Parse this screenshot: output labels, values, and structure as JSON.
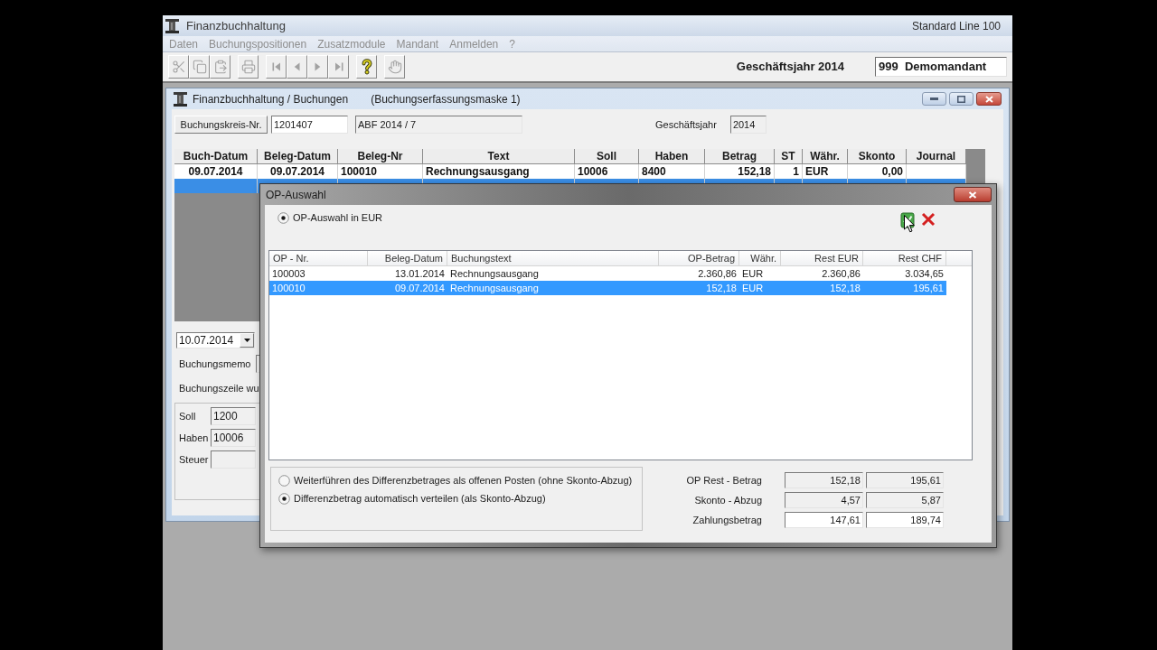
{
  "app_window": {
    "title": "Finanzbuchhaltung",
    "edition": "Standard Line 100"
  },
  "menu": [
    {
      "label": "Daten",
      "disabled": true
    },
    {
      "label": "Buchungspositionen",
      "disabled": true
    },
    {
      "label": "Zusatzmodule",
      "disabled": true
    },
    {
      "label": "Mandant",
      "disabled": true
    },
    {
      "label": "Anmelden",
      "disabled": true
    },
    {
      "label": "?",
      "disabled": true
    }
  ],
  "toolbar": {
    "groups": [
      [
        {
          "disabled": true
        },
        {
          "disabled": true
        },
        {
          "disabled": true
        }
      ],
      [
        {
          "disabled": true
        }
      ],
      [
        {
          "disabled": true
        },
        {
          "disabled": true
        },
        {
          "disabled": true
        },
        {
          "disabled": true
        }
      ],
      [
        {
          "disabled": false
        }
      ],
      [
        {
          "disabled": true
        }
      ]
    ],
    "fiscal_year": "Geschäftsjahr 2014",
    "client": "999  Demomandant"
  },
  "booking_window": {
    "title": "Finanzbuchhaltung / Buchungen",
    "subtitle": "(Buchungserfassungsmaske 1)",
    "circle_button": "Buchungskreis-Nr.",
    "circle_number": {
      "value": "1201407",
      "readonly": false
    },
    "circle_name": {
      "value": "ABF 2014 / 7",
      "readonly": true
    },
    "fiscal_year": {
      "label": "Geschäftsjahr",
      "value": "2014",
      "readonly": true
    },
    "table": {
      "columns": [
        "Buch-Datum",
        "Beleg-Datum",
        "Beleg-Nr",
        "Text",
        "Soll",
        "Haben",
        "Betrag",
        "ST",
        "Währ.",
        "Skonto",
        "Journal"
      ],
      "rows": [
        {
          "cells": [
            "09.07.2014",
            "09.07.2014",
            "100010",
            "Rechnungsausgang",
            "10006",
            "8400",
            "152,18",
            "1",
            "EUR",
            "0,00"
          ],
          "selected": false
        },
        {
          "selected": true
        }
      ]
    },
    "date": "10.07.2014",
    "memo_label": "Buchungsmemo",
    "status_text": "Buchungszeile wu",
    "accounts": [
      {
        "label": "Soll",
        "value": "1200",
        "readonly": true
      },
      {
        "label": "Haben",
        "value": "10006",
        "readonly": true
      },
      {
        "label": "Steuer",
        "readonly": true
      }
    ]
  },
  "op_dialog": {
    "title": "OP-Auswahl",
    "currency_option": {
      "label": "OP-Auswahl in EUR",
      "selected": true
    },
    "list": {
      "columns": [
        "OP - Nr.",
        "Beleg-Datum",
        "Buchungstext",
        "OP-Betrag",
        "Währ.",
        "Rest EUR",
        "Rest CHF"
      ],
      "rows": [
        {
          "cells": [
            "100003",
            "13.01.2014",
            "Rechnungsausgang",
            "2.360,86",
            "EUR",
            "2.360,86",
            "3.034,65"
          ],
          "selected": false
        },
        {
          "cells": [
            "100010",
            "09.07.2014",
            "Rechnungsausgang",
            "152,18",
            "EUR",
            "152,18",
            "195,61"
          ],
          "selected": true
        }
      ]
    },
    "difference_options": [
      {
        "label": "Weiterführen des Differenzbetrages als offenen Posten (ohne Skonto-Abzug)",
        "selected": false
      },
      {
        "label": "Differenzbetrag automatisch verteilen (als Skonto-Abzug)",
        "selected": true
      }
    ],
    "totals": [
      {
        "label": "OP Rest - Betrag",
        "values": [
          "152,18",
          "195,61"
        ],
        "readonly": true
      },
      {
        "label": "Skonto - Abzug",
        "values": [
          "4,57",
          "5,87"
        ],
        "readonly": true
      },
      {
        "label": "Zahlungsbetrag",
        "values": [
          "147,61",
          "189,74"
        ],
        "readonly": false
      }
    ]
  }
}
